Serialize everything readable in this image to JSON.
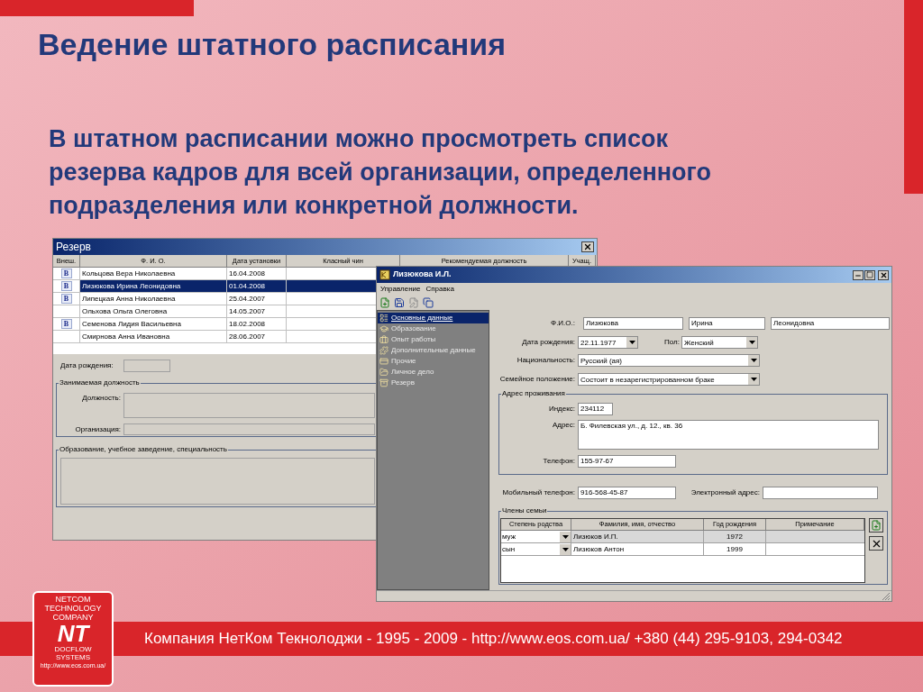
{
  "slide": {
    "title": "Ведение штатного расписания",
    "text_lines": [
      "В штатном расписании можно просмотреть список",
      "резерва кадров для всей организации, определенного",
      "подразделения или конкретной должности."
    ],
    "footer": "Компания НетКом Текнолоджи - 1995 - 2009 - http://www.eos.com.ua/ +380 (44) 295-9103, 294-0342"
  },
  "logo": {
    "top_lines": [
      "NETCOM",
      "TECHNOLOGY",
      "COMPANY"
    ],
    "mark": "NT",
    "bottom_lines": [
      "DOCFLOW",
      "SYSTEMS"
    ],
    "url": "http://www.eos.com.ua/"
  },
  "reserve_window": {
    "title": "Резерв",
    "columns": [
      "Внеш.",
      "Ф. И. О.",
      "Дата установки",
      "Класный чин",
      "Рекомендуемая должность",
      "Учащ."
    ],
    "rows": [
      {
        "mark": "B",
        "name": "Кольцова Вера Николаевна",
        "date": "16.04.2008",
        "selected": false
      },
      {
        "mark": "B",
        "name": "Лизюкова Ирина Леонидовна",
        "date": "01.04.2008",
        "selected": true
      },
      {
        "mark": "B",
        "name": "Липецкая Анна Николаевна",
        "date": "25.04.2007",
        "selected": false
      },
      {
        "name": "Ольхова Ольга Олеговна",
        "date": "14.05.2007",
        "selected": false
      },
      {
        "mark": "B",
        "name": "Семенова Лидия Васильевна",
        "date": "18.02.2008",
        "selected": false
      },
      {
        "name": "Смирнова Анна Ивановна",
        "date": "28.06.2007",
        "selected": false
      }
    ],
    "birth_date_label": "Дата рождения:",
    "position_group": {
      "title": "Занимаемая должность",
      "position_label": "Должность:",
      "organization_label": "Организация:"
    },
    "education_group": {
      "title": "Образование, учебное заведение, специальность"
    }
  },
  "card_window": {
    "title": "Лизюкова И.Л.",
    "menu": [
      "Управление",
      "Справка"
    ],
    "nav": [
      {
        "label": "Основные данные",
        "selected": true
      },
      {
        "label": "Образование",
        "selected": false
      },
      {
        "label": "Опыт работы",
        "selected": false
      },
      {
        "label": "Дополнительные данные",
        "selected": false
      },
      {
        "label": "Прочие",
        "selected": false
      },
      {
        "label": "Личное дело",
        "selected": false
      },
      {
        "label": "Резерв",
        "selected": false
      }
    ],
    "fio": {
      "label": "Ф.И.О.:",
      "values": [
        "Лизюкова",
        "Ирина",
        "Леонидовна"
      ]
    },
    "birth_date": {
      "label": "Дата рождения:",
      "value": "22.11.1977"
    },
    "sex": {
      "label": "Пол:",
      "value": "Женский"
    },
    "nationality": {
      "label": "Национальность:",
      "value": "Русский (ая)"
    },
    "marital": {
      "label": "Семейное положение:",
      "value": "Состоит в незарегистрированном браке"
    },
    "address_group": {
      "title": "Адрес проживания",
      "index": {
        "label": "Индекс:",
        "value": "234112"
      },
      "address": {
        "label": "Адрес:",
        "value": "Б. Филевская ул., д. 12., кв. 36"
      },
      "phone": {
        "label": "Телефон:",
        "value": "155-97-67"
      }
    },
    "mobile": {
      "label": "Мобильный телефон:",
      "value": "916-568-45-87"
    },
    "email": {
      "label": "Электронный адрес:"
    },
    "family": {
      "title": "Члены семьи",
      "columns": [
        "Степень родства",
        "Фамилия, имя, отчество",
        "Год рождения",
        "Примечание"
      ],
      "rows": [
        {
          "relation": "муж",
          "name": "Лизюков И.П.",
          "year": "1972",
          "selected": true
        },
        {
          "relation": "сын",
          "name": "Лизюков Антон",
          "year": "1999",
          "selected": false
        }
      ]
    }
  }
}
